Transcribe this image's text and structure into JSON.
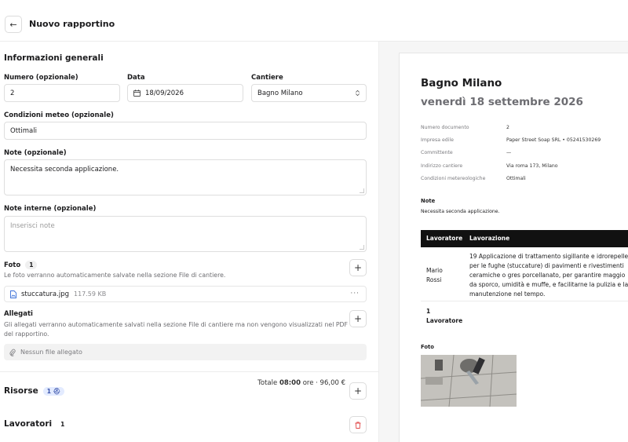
{
  "header": {
    "title": "Nuovo rapportino",
    "back_icon": "←"
  },
  "form": {
    "section_title": "Informazioni generali",
    "numero": {
      "label": "Numero (opzionale)",
      "value": "2"
    },
    "data": {
      "label": "Data",
      "value": "18/09/2026"
    },
    "cantiere": {
      "label": "Cantiere",
      "value": "Bagno Milano"
    },
    "meteo": {
      "label": "Condizioni meteo (opzionale)",
      "value": "Ottimali"
    },
    "note": {
      "label": "Note (opzionale)",
      "value": "Necessita seconda applicazione."
    },
    "note_interne": {
      "label": "Note interne (opzionale)",
      "placeholder": "Inserisci note"
    },
    "foto": {
      "label": "Foto",
      "count": "1",
      "hint": "Le foto verranno automaticamente salvate nella sezione File di cantiere.",
      "file_name": "stuccatura.jpg",
      "file_size": "117.59 KB"
    },
    "allegati": {
      "label": "Allegati",
      "hint_line1": "Gli allegati verranno automaticamente salvati nella sezione File di cantiere ma non vengono visualizzati nel PDF",
      "hint_line2": "del rapportino.",
      "empty": "Nessun file allegato"
    },
    "risorse": {
      "label": "Risorse",
      "badge": "1"
    },
    "lavoratori": {
      "label": "Lavoratori",
      "count": "1",
      "total_prefix": "Totale ",
      "total_hours": "08:00",
      "total_suffix": " ore · 96,00 €"
    }
  },
  "preview": {
    "title": "Bagno Milano",
    "date": "venerdì 18 settembre 2026",
    "meta": [
      {
        "key": "Numero documento",
        "value": "2"
      },
      {
        "key": "Impresa edile",
        "value": "Paper Street Soap SRL • 05241530269"
      },
      {
        "key": "Committente",
        "value": "—"
      },
      {
        "key": "Indirizzo cantiere",
        "value": "Via roma 173, Milano"
      },
      {
        "key": "Condizioni metereologiche",
        "value": "Ottimali"
      }
    ],
    "note_label": "Note",
    "note_value": "Necessita seconda applicazione.",
    "table": {
      "col_worker": "Lavoratore",
      "col_work": "Lavorazione",
      "worker_first": "Mario",
      "worker_last": "Rossi",
      "desc_lines": [
        "19 Applicazione di trattamento sigillante e idrorepelle",
        "per le fughe (stuccature) di pavimenti e rivestimenti",
        "ceramiche o gres porcellanato, per garantire maggio",
        "da sporco, umidità e muffe, e facilitarne la pulizia e la",
        "manutenzione nel tempo."
      ],
      "count_number": "1",
      "count_label": "Lavoratore"
    },
    "foto_label": "Foto"
  }
}
